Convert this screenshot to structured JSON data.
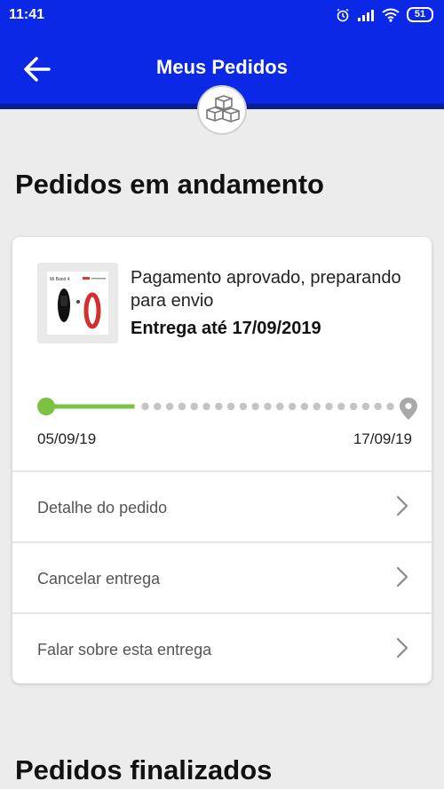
{
  "status_bar": {
    "time": "11:41",
    "battery": "51"
  },
  "header": {
    "title": "Meus Pedidos"
  },
  "sections": {
    "in_progress_title": "Pedidos em andamento",
    "finished_title": "Pedidos finalizados"
  },
  "order": {
    "status": "Pagamento aprovado, preparando para envio",
    "delivery": "Entrega até 17/09/2019",
    "progress_fraction": 0.25,
    "start_date": "05/09/19",
    "end_date": "17/09/19",
    "product_image_text": "Mi Band 4"
  },
  "actions": [
    {
      "label": "Detalhe do pedido"
    },
    {
      "label": "Cancelar entrega"
    },
    {
      "label": "Falar sobre esta entrega"
    }
  ],
  "colors": {
    "primary": "#0a28e6",
    "progress": "#7cc242",
    "dots": "#c4c4c4"
  }
}
